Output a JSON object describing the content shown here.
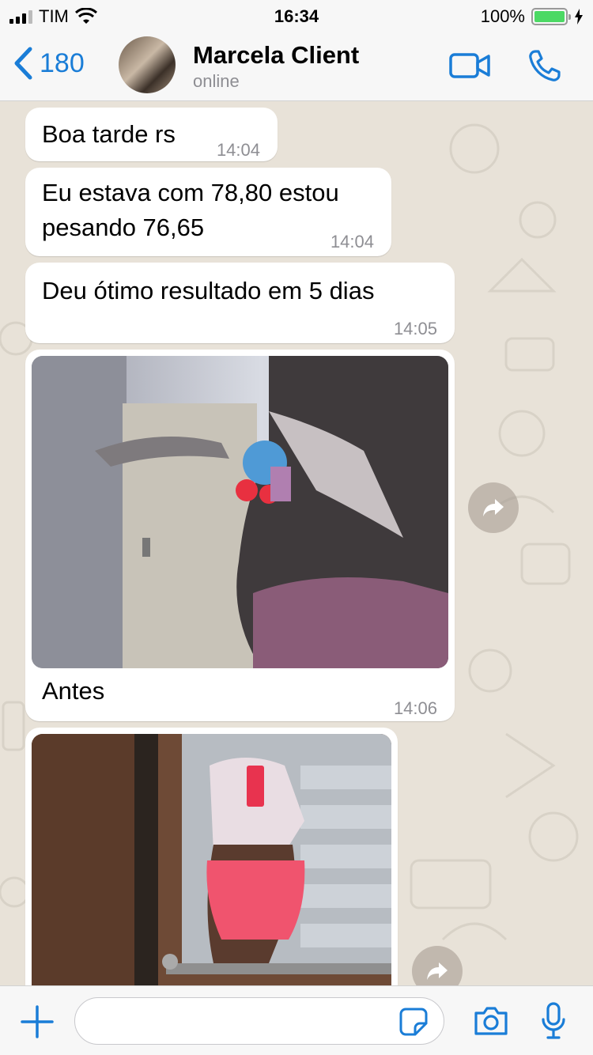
{
  "status_bar": {
    "carrier": "TIM",
    "time": "16:34",
    "battery": "100%"
  },
  "header": {
    "back_count": "180",
    "contact_name": "Marcela Client",
    "contact_status": "online"
  },
  "messages": [
    {
      "text": "Boa tarde rs",
      "time": "14:04"
    },
    {
      "text_line1": "Eu estava com 78,80 estou",
      "text_line2": "pesando  76,65",
      "time": "14:04"
    },
    {
      "text": "Deu ótimo resultado em 5 dias",
      "time": "14:05"
    },
    {
      "caption": "Antes",
      "time": "14:06"
    }
  ],
  "colors": {
    "accent": "#1a7dd7",
    "chat_background": "#e8e2d8",
    "bubble": "#ffffff",
    "battery_fill": "#4cd964"
  }
}
